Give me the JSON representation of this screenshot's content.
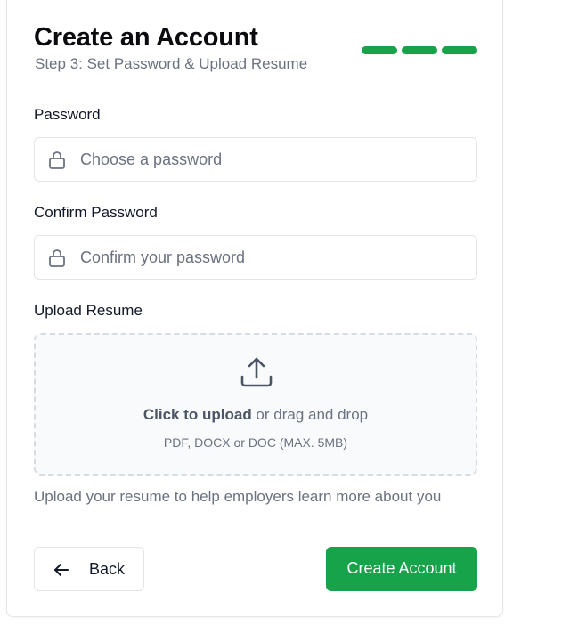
{
  "header": {
    "title": "Create an Account",
    "subtitle": "Step 3: Set Password & Upload Resume",
    "steps_total": 3,
    "steps_completed": 3,
    "step_color": "#16a34a"
  },
  "password": {
    "label": "Password",
    "placeholder": "Choose a password",
    "value": "",
    "icon": "lock-icon"
  },
  "confirm_password": {
    "label": "Confirm Password",
    "placeholder": "Confirm your password",
    "value": "",
    "icon": "lock-icon"
  },
  "resume": {
    "label": "Upload Resume",
    "icon": "upload-icon",
    "click_text": "Click to upload",
    "drag_text": " or drag and drop",
    "formats": "PDF, DOCX or DOC (MAX. 5MB)",
    "helper": "Upload your resume to help employers learn more about you"
  },
  "actions": {
    "back_label": "Back",
    "back_icon": "arrow-left-icon",
    "create_label": "Create Account",
    "primary_color": "#16a34a"
  }
}
